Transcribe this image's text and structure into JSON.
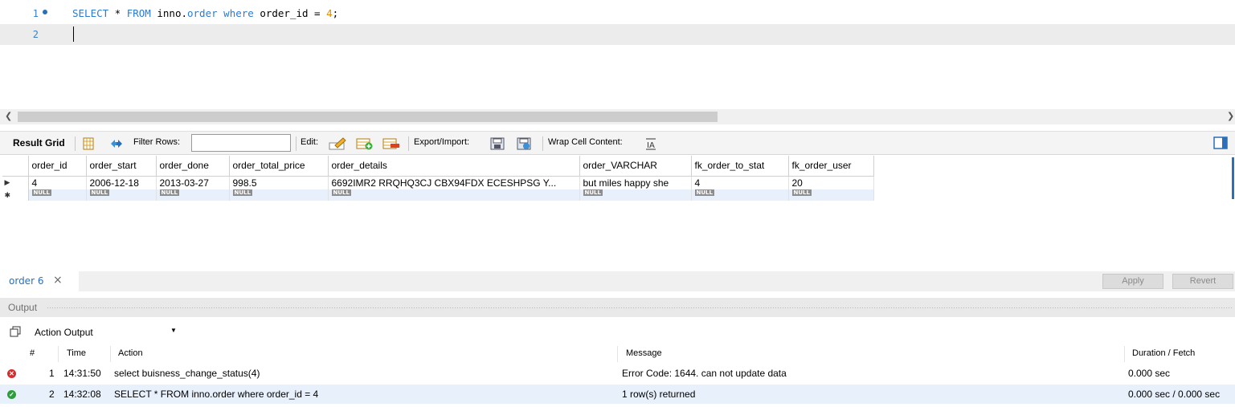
{
  "editor": {
    "line_numbers": [
      "1",
      "2"
    ],
    "line1": {
      "kw_select": "SELECT",
      "star": " * ",
      "kw_from": "FROM",
      "schema": " inno.",
      "table": "order",
      "kw_where": " where",
      "column": " order_id = ",
      "value": "4",
      "semicolon": ";"
    }
  },
  "result_toolbar": {
    "result_grid_label": "Result Grid",
    "filter_rows_label": "Filter Rows:",
    "filter_value": "",
    "edit_label": "Edit:",
    "export_import_label": "Export/Import:",
    "wrap_label": "Wrap Cell Content:"
  },
  "grid": {
    "columns": [
      "order_id",
      "order_start",
      "order_done",
      "order_total_price",
      "order_details",
      "order_VARCHAR",
      "fk_order_to_stat",
      "fk_order_user"
    ],
    "rows": [
      [
        "4",
        "2006-12-18",
        "2013-03-27",
        "998.5",
        "6692IMR2 RRQHQ3CJ CBX94FDX ECESHPSG Y...",
        "but miles happy she",
        "4",
        "20"
      ]
    ],
    "null_label": "NULL"
  },
  "tabs": {
    "active_tab": "order 6",
    "close_symbol": "×",
    "apply_label": "Apply",
    "revert_label": "Revert"
  },
  "output": {
    "title": "Output",
    "selector_value": "Action Output",
    "headers": {
      "num": "#",
      "time": "Time",
      "action": "Action",
      "message": "Message",
      "duration": "Duration / Fetch"
    },
    "rows": [
      {
        "status": "error",
        "num": "1",
        "time": "14:31:50",
        "action": "select buisness_change_status(4)",
        "message": "Error Code: 1644. can not update data",
        "duration": "0.000 sec"
      },
      {
        "status": "ok",
        "num": "2",
        "time": "14:32:08",
        "action": "SELECT * FROM inno.order where order_id = 4",
        "message": "1 row(s) returned",
        "duration": "0.000 sec / 0.000 sec"
      }
    ]
  },
  "colors": {
    "keyword": "#2b7bd3",
    "number": "#e08a00",
    "error": "#d32f2f",
    "success": "#2e9d3c",
    "selection_row": "#e8f0fb"
  }
}
